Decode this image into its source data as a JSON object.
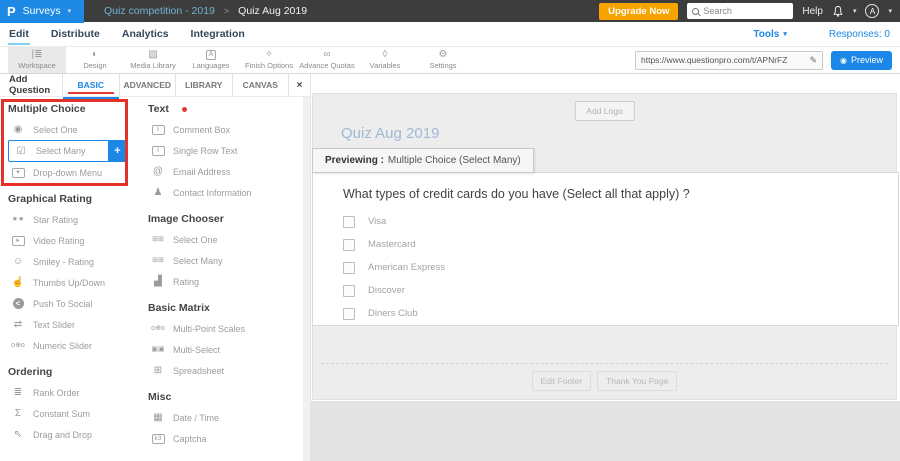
{
  "topbar": {
    "product": "Surveys",
    "breadcrumb": {
      "parent": "Quiz competition - 2019",
      "separator": ">",
      "current": "Quiz Aug 2019"
    },
    "upgrade_label": "Upgrade Now",
    "search_placeholder": "Search",
    "help_label": "Help",
    "avatar_initial": "A"
  },
  "menubar": {
    "items": [
      "Edit",
      "Distribute",
      "Analytics",
      "Integration"
    ],
    "active": "Edit",
    "tools_label": "Tools",
    "responses_label": "Responses: 0"
  },
  "toolbar": {
    "items": [
      {
        "label": "Workspace",
        "icon": "workspace-icon",
        "active": true
      },
      {
        "label": "Design",
        "icon": "design-icon"
      },
      {
        "label": "Media Library",
        "icon": "media-library-icon"
      },
      {
        "label": "Languages",
        "icon": "languages-icon"
      },
      {
        "label": "Finish Options",
        "icon": "finish-options-icon"
      },
      {
        "label": "Advance Quotas",
        "icon": "advance-quotas-icon"
      },
      {
        "label": "Variables",
        "icon": "variables-icon"
      },
      {
        "label": "Settings",
        "icon": "settings-icon"
      }
    ],
    "url_value": "https://www.questionpro.com/t/APNrFZ",
    "preview_label": "Preview"
  },
  "question_panel": {
    "title": "Add Question",
    "tabs": [
      "BASIC",
      "ADVANCED",
      "LIBRARY",
      "CANVAS"
    ],
    "active_tab": "BASIC",
    "close_icon": "×",
    "column1": [
      {
        "header": "Multiple Choice",
        "highlight": true,
        "items": [
          {
            "label": "Select One",
            "icon": "radio-icon"
          },
          {
            "label": "Select Many",
            "icon": "checkboxes-icon",
            "selected": true,
            "add_button": "+"
          },
          {
            "label": "Drop-down Menu",
            "icon": "dropdown-icon"
          }
        ]
      },
      {
        "header": "Graphical Rating",
        "items": [
          {
            "label": "Star Rating",
            "icon": "star-rating-icon"
          },
          {
            "label": "Video Rating",
            "icon": "video-icon"
          },
          {
            "label": "Smiley - Rating",
            "icon": "smiley-icon"
          },
          {
            "label": "Thumbs Up/Down",
            "icon": "thumbs-icon"
          },
          {
            "label": "Push To Social",
            "icon": "share-icon"
          },
          {
            "label": "Text Slider",
            "icon": "text-slider-icon"
          },
          {
            "label": "Numeric Slider",
            "icon": "numeric-slider-icon"
          }
        ]
      },
      {
        "header": "Ordering",
        "items": [
          {
            "label": "Rank Order",
            "icon": "rank-icon"
          },
          {
            "label": "Constant Sum",
            "icon": "sum-icon"
          },
          {
            "label": "Drag and Drop",
            "icon": "drag-icon"
          }
        ]
      }
    ],
    "column2": [
      {
        "header": "Text",
        "new_dot": true,
        "items": [
          {
            "label": "Comment Box",
            "icon": "comment-icon"
          },
          {
            "label": "Single Row Text",
            "icon": "single-row-icon"
          },
          {
            "label": "Email Address",
            "icon": "email-icon"
          },
          {
            "label": "Contact Information",
            "icon": "contact-icon"
          }
        ]
      },
      {
        "header": "Image Chooser",
        "items": [
          {
            "label": "Select One",
            "icon": "image-select-one-icon"
          },
          {
            "label": "Select Many",
            "icon": "image-select-many-icon"
          },
          {
            "label": "Rating",
            "icon": "image-rating-icon"
          }
        ]
      },
      {
        "header": "Basic Matrix",
        "items": [
          {
            "label": "Multi-Point Scales",
            "icon": "multi-point-icon"
          },
          {
            "label": "Multi-Select",
            "icon": "multi-select-icon"
          },
          {
            "label": "Spreadsheet",
            "icon": "spreadsheet-icon"
          }
        ]
      },
      {
        "header": "Misc",
        "items": [
          {
            "label": "Date / Time",
            "icon": "date-icon"
          },
          {
            "label": "Captcha",
            "icon": "captcha-icon"
          }
        ]
      }
    ]
  },
  "preview": {
    "add_logo_label": "Add Logo",
    "survey_title": "Quiz Aug 2019",
    "tooltip": {
      "bold": "Previewing :",
      "text": "Multiple Choice (Select Many)"
    },
    "question": "What types of credit cards do you have (Select all that apply) ?",
    "options": [
      "Visa",
      "Mastercard",
      "American Express",
      "Discover",
      "Diners Club"
    ],
    "footer_buttons": [
      "Edit Footer",
      "Thank You Page"
    ]
  },
  "colors": {
    "accent_blue": "#1b87e6",
    "logo_blue": "#1e88e5",
    "orange": "#f7a400",
    "annotation_red": "#e4322b",
    "topbar_dark": "#3d3d3d",
    "nav_text": "#33475b",
    "survey_title_blue": "#9fb9d4"
  }
}
